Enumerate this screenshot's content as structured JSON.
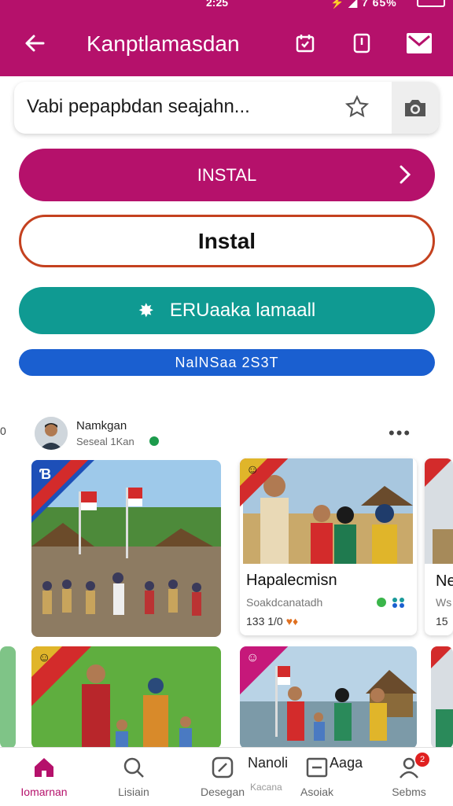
{
  "status_bar": {
    "time": "2:25",
    "right": "⚡ ◢ 7 65%"
  },
  "header": {
    "title": "Kanptlamasdan",
    "icons": [
      "back-arrow-icon",
      "calendar-icon",
      "bookmark-icon",
      "mail-icon"
    ],
    "color": "#b5116b"
  },
  "search": {
    "placeholder": "Vabi pepapbdan seajahn..."
  },
  "buttons": {
    "primary": "INSTAL",
    "outline": "Instal",
    "teal": "ERUaaka lamaall",
    "blue": "NalNSaa 2S3T"
  },
  "post": {
    "edge_left": "0",
    "user_name": "Namkgan",
    "user_sub": "Seseal 1Kan"
  },
  "cards": [
    {
      "ribbon": "Ɓ"
    },
    {
      "ribbon": "☺",
      "title": "Hapalecmisn",
      "subtitle": "Soakdcanatadh",
      "stat": "133 1/0",
      "heart": "♥♦"
    },
    {
      "ribbon": "⊠",
      "title": "Ne",
      "subtitle": "Ws",
      "stat": "15"
    },
    {
      "ribbon": "☺"
    },
    {
      "ribbon": "☺"
    },
    {
      "ribbon": ""
    }
  ],
  "nav": [
    {
      "label": "Iomarnan",
      "icon": "home-icon",
      "active": true
    },
    {
      "label": "Lisiain",
      "icon": "search-icon"
    },
    {
      "label": "Desegan",
      "icon": "edit-icon"
    },
    {
      "label": "Asoiak",
      "icon": "list-icon"
    },
    {
      "label": "Sebms",
      "icon": "profile-icon",
      "badge": "2"
    }
  ],
  "nav_popup": {
    "label": "Nanoli",
    "label2": "Aaga",
    "sub": "Kacana"
  }
}
